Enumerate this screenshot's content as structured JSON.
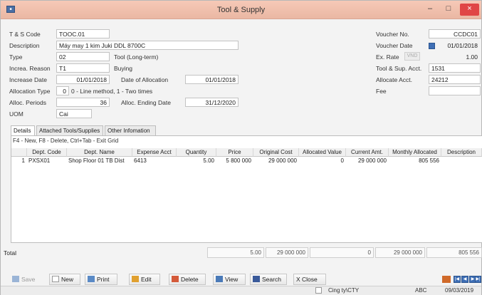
{
  "window": {
    "title": "Tool & Supply",
    "icon": "app-icon",
    "minimize": "–",
    "maximize": "□",
    "close": "×"
  },
  "form": {
    "code_label": "T & S Code",
    "code": "TOOC.01",
    "description_label": "Description",
    "description": "Máy may 1 kim Juki DDL 8700C",
    "type_label": "Type",
    "type": "02",
    "type_name": "Tool (Long-term)",
    "reason_label": "Increa. Reason",
    "reason": "T1",
    "reason_name": "Buying",
    "increase_date_label": "Increase Date",
    "increase_date": "01/01/2018",
    "alloc_date_label": "Date of Allocation",
    "alloc_date": "01/01/2018",
    "alloc_type_label": "Allocation Type",
    "alloc_type": "0",
    "alloc_type_desc": "0 - Line method, 1 - Two times",
    "alloc_periods_label": "Alloc. Periods",
    "alloc_periods": "36",
    "alloc_end_label": "Alloc. Ending Date",
    "alloc_end": "31/12/2020",
    "uom_label": "UOM",
    "uom": "Cai",
    "voucher_no_label": "Voucher No.",
    "voucher_no": "CCDC01",
    "voucher_date_label": "Voucher Date",
    "voucher_date": "01/01/2018",
    "rate_label": "Ex. Rate",
    "currency": "VND",
    "rate": "1.00",
    "sup_acct_label": "Tool & Sup. Acct.",
    "sup_acct": "1531",
    "alloc_acct_label": "Allocate Acct.",
    "alloc_acct": "24212",
    "fee_label": "Fee",
    "fee": ""
  },
  "tabs": [
    {
      "label": "Details"
    },
    {
      "label": "Attached Tools/Supplies"
    },
    {
      "label": "Other Infomation"
    }
  ],
  "grid": {
    "hint": "F4 - New, F8 - Delete, Ctrl+Tab - Exit Grid",
    "columns": [
      "Dept. Code",
      "Dept. Name",
      "Expense Acct",
      "Quantity",
      "Price",
      "Original Cost",
      "Allocated Value",
      "Current Amt.",
      "Monthly Allocated",
      "Description"
    ],
    "rows": [
      {
        "no": "1",
        "dept_code": "PXSX01",
        "dept_name": "Shop Floor 01 TB Dist",
        "expense_acct": "6413",
        "quantity": "5.00",
        "price": "5 800 000",
        "original_cost": "29 000 000",
        "allocated_value": "0",
        "current_amt": "29 000 000",
        "monthly_allocated": "805 556",
        "description": ""
      }
    ]
  },
  "totals": {
    "label": "Total",
    "quantity": "5.00",
    "original_cost": "29 000 000",
    "allocated_value": "0",
    "current_amt": "29 000 000",
    "monthly_allocated": "805 556"
  },
  "toolbar": {
    "save": "Save",
    "new": "New",
    "print": "Print",
    "edit": "Edit",
    "delete": "Delete",
    "view": "View",
    "search": "Search",
    "close": "X Close"
  },
  "status": {
    "unit": "Cing ty\\CTY",
    "user": "ABC",
    "date": "09/03/2019"
  }
}
